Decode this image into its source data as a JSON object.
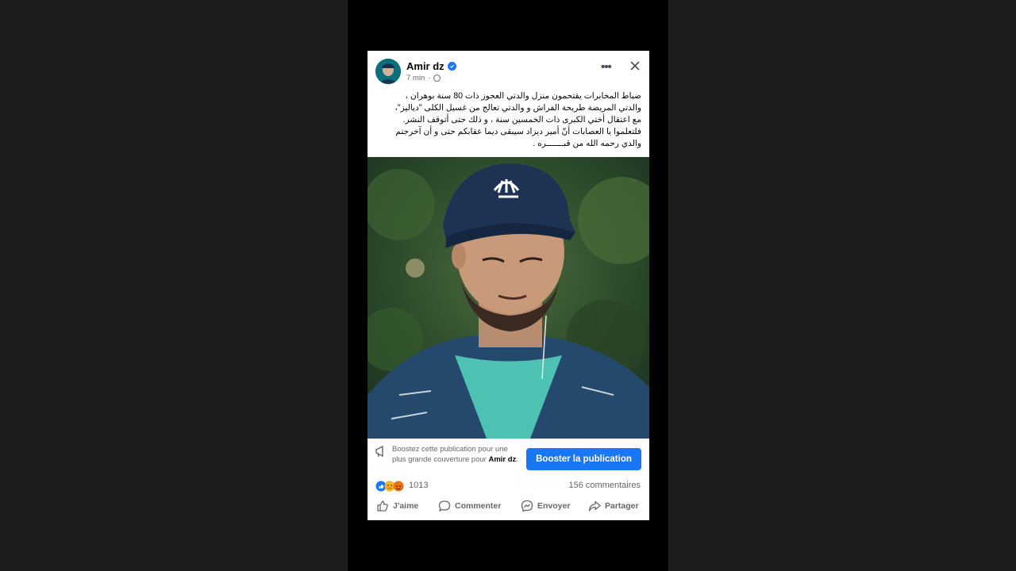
{
  "post": {
    "author": "Amir dz",
    "time": "7 min",
    "separator": "·",
    "more": "•••",
    "text": "ضباط المخابرات يقتحمون منزل والدتي العجوز ذات 80 سنة بوهران ،\nوالدتي المريضة طريحة الفراش و والدتي تعالج من غسيل الكلى \"دياليز\"،\nمع اعتقال أختي الكبرى ذات الخمسين سنة ، و ذلك حتى أتوقف النشر.\nفلتعلموا يا العصابات أنّ أمير ديزاد سيبقى ديما عقابكم حتى و أن آخرجتم\nوالدي رحمه الله من قبـــــــره  .",
    "boost_text_1": "Boostez cette publication pour une plus grande couverture pour",
    "boost_author": "Amir dz",
    "boost_text_end": ".",
    "boost_button": "Booster la publication",
    "reaction_count": "1013",
    "comments": "156 commentaires",
    "actions": {
      "like": "J'aime",
      "comment": "Commenter",
      "send": "Envoyer",
      "share": "Partager"
    }
  },
  "colors": {
    "accent": "#1877f2",
    "secondary_text": "#65676b",
    "background": "#000000"
  },
  "icons": [
    "verified-badge-icon",
    "globe-icon",
    "more-options-icon",
    "close-icon",
    "megaphone-icon",
    "like-reaction-icon",
    "care-reaction-icon",
    "angry-reaction-icon",
    "thumbs-up-icon",
    "comment-bubble-icon",
    "messenger-icon",
    "share-arrow-icon"
  ]
}
